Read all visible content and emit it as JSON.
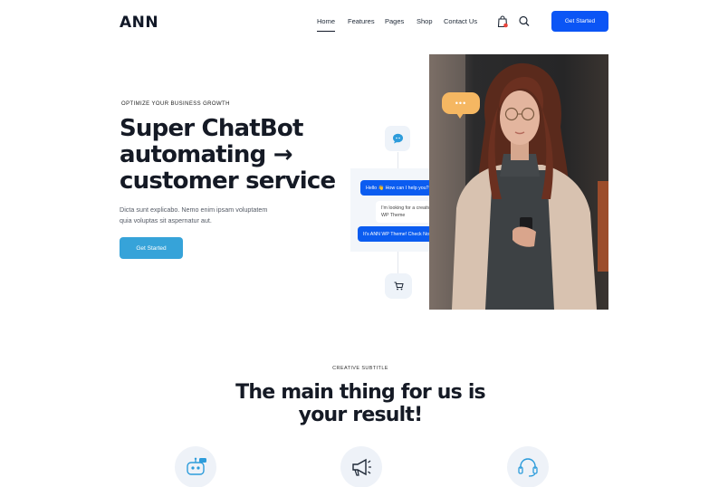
{
  "header": {
    "logo": "ANN",
    "nav": [
      "Home",
      "Features",
      "Pages",
      "Shop",
      "Contact Us"
    ],
    "cta": "Get Started",
    "icons": [
      "shopping-bag-icon",
      "search-icon"
    ]
  },
  "hero": {
    "eyebrow": "OPTIMIZE YOUR BUSINESS GROWTH",
    "title_line1": "Super ChatBot",
    "title_line2": "automating →",
    "title_line3": "customer service",
    "desc_line1": "Dicta sunt explicabo. Nemo enim ipsam voluptatem",
    "desc_line2": "quia voluptas sit aspernatur aut.",
    "cta": "Get Started"
  },
  "chat": {
    "msg1": "Hello 👋 How can I help you?",
    "msg2": "I'm looking for a creative WP Theme",
    "msg3": "It's ANN WP Theme! Check Now!",
    "typing": "•••"
  },
  "section2": {
    "subtitle": "CREATIVE SUBTITLE",
    "title_line1": "The main thing for us is",
    "title_line2": "your result!"
  },
  "colors": {
    "primary": "#0b55f5",
    "hero_button": "#36a3d9",
    "accent_orange": "#f5b762"
  }
}
